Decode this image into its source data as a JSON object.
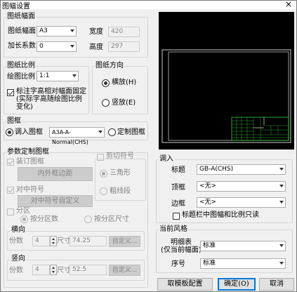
{
  "window": {
    "title": "图幅设置",
    "close_glyph": "×"
  },
  "paper": {
    "group_title": "图纸幅面",
    "size_label": "图纸幅面",
    "size_value": "A3",
    "extend_label": "加长系数",
    "extend_value": "0",
    "width_label": "宽度",
    "width_value": "420",
    "height_label": "高度",
    "height_value": "297"
  },
  "scale": {
    "group_title": "图纸比例",
    "ratio_label": "绘图比例",
    "ratio_value": "1:1",
    "fixed_text_label": "标注字高相对幅面固定(实际字高随绘图比例变化)",
    "fixed_text_checked": true
  },
  "orientation": {
    "group_title": "图纸方向",
    "landscape_label": "横放(H)",
    "portrait_label": "竖放(E)",
    "selected": "landscape"
  },
  "frame": {
    "group_title": "图框",
    "load_label": "调入图框",
    "load_value": "A3A-A-Normal(CHS)",
    "custom_label": "定制图框",
    "selected": "load"
  },
  "param": {
    "group_title": "参数定制图框",
    "binding_label": "装订图框",
    "inner_outer_btn": "内外框边距",
    "center_mark_label": "对中符号",
    "center_mark_btn": "对中符号自定义",
    "trim_label": "剪切符号",
    "triangle_label": "三角形",
    "thick_line_label": "粗线段",
    "zone_label": "分区",
    "by_count_label": "按分区数",
    "by_size_label": "按分区尺寸",
    "horizontal_title": "横向",
    "h_count_label": "份数",
    "h_count_value": "4",
    "h_size_label": "尺寸",
    "h_size_value": "74.25",
    "h_custom_btn": "自定义...",
    "vertical_title": "竖向",
    "v_count_label": "份数",
    "v_count_value": "4",
    "v_size_label": "尺寸",
    "v_size_value": "52.5",
    "v_custom_btn": "自定义..."
  },
  "load": {
    "group_title": "调入",
    "title_block_label": "标题",
    "title_block_value": "GB-A(CHS)",
    "top_frame_label": "顶框",
    "top_frame_value": "<无>",
    "side_frame_label": "边框",
    "side_frame_value": "<无>",
    "scale_check_label": "标题栏中图幅和比例只读"
  },
  "style": {
    "group_title": "当前风格",
    "detail_label": "明细表",
    "detail_sub_label": "(仅当前幅面)",
    "detail_value": "标准",
    "serial_label": "序号",
    "serial_value": "标准"
  },
  "footer": {
    "template_btn": "取模板配置",
    "ok_btn": "确定(O)",
    "cancel_btn": "取消"
  },
  "colors": {
    "preview_bg": "#000000",
    "frame_line": "#ffffff",
    "titleblock_line": "#33cc33"
  }
}
